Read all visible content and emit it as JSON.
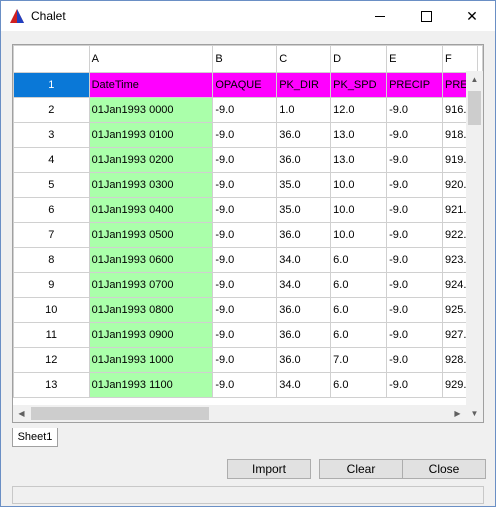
{
  "window": {
    "title": "Chalet",
    "icon": "chalet-app-icon"
  },
  "grid": {
    "columns": [
      "A",
      "B",
      "C",
      "D",
      "E",
      "F"
    ],
    "rows": [
      {
        "n": "1",
        "cells": [
          "DateTime",
          "OPAQUE",
          "PK_DIR",
          "PK_SPD",
          "PRECIP",
          "PRES"
        ]
      },
      {
        "n": "2",
        "cells": [
          "01Jan1993 0000",
          "-9.0",
          "1.0",
          "12.0",
          "-9.0",
          "916."
        ]
      },
      {
        "n": "3",
        "cells": [
          "01Jan1993 0100",
          "-9.0",
          "36.0",
          "13.0",
          "-9.0",
          "918."
        ]
      },
      {
        "n": "4",
        "cells": [
          "01Jan1993 0200",
          "-9.0",
          "36.0",
          "13.0",
          "-9.0",
          "919."
        ]
      },
      {
        "n": "5",
        "cells": [
          "01Jan1993 0300",
          "-9.0",
          "35.0",
          "10.0",
          "-9.0",
          "920."
        ]
      },
      {
        "n": "6",
        "cells": [
          "01Jan1993 0400",
          "-9.0",
          "35.0",
          "10.0",
          "-9.0",
          "921."
        ]
      },
      {
        "n": "7",
        "cells": [
          "01Jan1993 0500",
          "-9.0",
          "36.0",
          "10.0",
          "-9.0",
          "922."
        ]
      },
      {
        "n": "8",
        "cells": [
          "01Jan1993 0600",
          "-9.0",
          "34.0",
          "6.0",
          "-9.0",
          "923."
        ]
      },
      {
        "n": "9",
        "cells": [
          "01Jan1993 0700",
          "-9.0",
          "34.0",
          "6.0",
          "-9.0",
          "924."
        ]
      },
      {
        "n": "10",
        "cells": [
          "01Jan1993 0800",
          "-9.0",
          "36.0",
          "6.0",
          "-9.0",
          "925."
        ]
      },
      {
        "n": "11",
        "cells": [
          "01Jan1993 0900",
          "-9.0",
          "36.0",
          "6.0",
          "-9.0",
          "927."
        ]
      },
      {
        "n": "12",
        "cells": [
          "01Jan1993 1000",
          "-9.0",
          "36.0",
          "7.0",
          "-9.0",
          "928."
        ]
      },
      {
        "n": "13",
        "cells": [
          "01Jan1993 1100",
          "-9.0",
          "34.0",
          "6.0",
          "-9.0",
          "929."
        ]
      }
    ]
  },
  "sheet_tab": "Sheet1",
  "buttons": {
    "import": "Import",
    "clear": "Clear",
    "close": "Close"
  },
  "colors": {
    "header_row": "#ff00ff",
    "column_a": "#aaffaa",
    "selected": "#0a78d7"
  }
}
